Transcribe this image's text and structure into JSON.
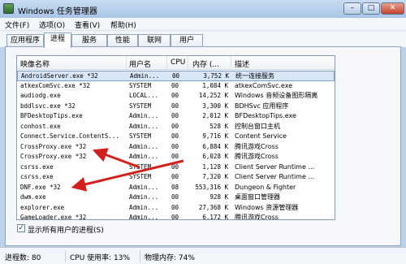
{
  "window": {
    "title": "Windows 任务管理器"
  },
  "controls": {
    "minimize": "–",
    "maximize": "□",
    "close": "✕"
  },
  "menu": [
    "文件(F)",
    "选项(O)",
    "查看(V)",
    "帮助(H)"
  ],
  "tabs": [
    "应用程序",
    "进程",
    "服务",
    "性能",
    "联网",
    "用户"
  ],
  "active_tab": "进程",
  "table": {
    "headers": [
      "映像名称",
      "用户名",
      "CPU",
      "内存 (...",
      "描述"
    ],
    "rows": [
      {
        "name": "AndroidServer.exe *32",
        "user": "Admin...",
        "cpu": "00",
        "mem": "3,752 K",
        "desc": "统一连接服务",
        "selected": true
      },
      {
        "name": "atkexComSvc.exe *32",
        "user": "SYSTEM",
        "cpu": "00",
        "mem": "1,084 K",
        "desc": "atkexComSvc.exe"
      },
      {
        "name": "audiodg.exe",
        "user": "LOCAL...",
        "cpu": "00",
        "mem": "14,252 K",
        "desc": "Windows 音频设备图形隔离"
      },
      {
        "name": "bddlsvc.exe *32",
        "user": "SYSTEM",
        "cpu": "00",
        "mem": "3,300 K",
        "desc": "BDHSvc 应用程序"
      },
      {
        "name": "BFDesktopTips.exe",
        "user": "Admin...",
        "cpu": "00",
        "mem": "2,012 K",
        "desc": "BFDesktopTips.exe"
      },
      {
        "name": "conhost.exe",
        "user": "Admin...",
        "cpu": "00",
        "mem": "528 K",
        "desc": "控制台窗口主机"
      },
      {
        "name": "Connect.Service.ContentS...",
        "user": "SYSTEM",
        "cpu": "00",
        "mem": "9,716 K",
        "desc": "Content Service"
      },
      {
        "name": "CrossProxy.exe *32",
        "user": "Admin...",
        "cpu": "00",
        "mem": "6,884 K",
        "desc": "腾讯游戏Cross"
      },
      {
        "name": "CrossProxy.exe *32",
        "user": "Admin...",
        "cpu": "00",
        "mem": "6,028 K",
        "desc": "腾讯游戏Cross"
      },
      {
        "name": "csrss.exe",
        "user": "SYSTEM",
        "cpu": "00",
        "mem": "1,128 K",
        "desc": "Client Server Runtime ..."
      },
      {
        "name": "csrss.exe",
        "user": "SYSTEM",
        "cpu": "00",
        "mem": "7,320 K",
        "desc": "Client Server Runtime ..."
      },
      {
        "name": "DNF.exe *32",
        "user": "Admin...",
        "cpu": "08",
        "mem": "553,316 K",
        "desc": "Dungeon & Fighter"
      },
      {
        "name": "dwm.exe",
        "user": "Admin...",
        "cpu": "00",
        "mem": "928 K",
        "desc": "桌面窗口管理器"
      },
      {
        "name": "explorer.exe",
        "user": "Admin...",
        "cpu": "00",
        "mem": "27,368 K",
        "desc": "Windows 资源管理器"
      },
      {
        "name": "GameLoader.exe *32",
        "user": "Admin...",
        "cpu": "00",
        "mem": "6,172 K",
        "desc": "腾讯游戏Cross"
      }
    ]
  },
  "show_all_processes": {
    "label": "显示所有用户的进程(S)",
    "checked": true,
    "check_glyph": "✓"
  },
  "status": {
    "processes": "进程数: 80",
    "cpu": "CPU 使用率: 13%",
    "memory": "物理内存: 74%"
  },
  "colors": {
    "annotation_arrow": "#d2201c",
    "selection": "#d8e6f8"
  }
}
